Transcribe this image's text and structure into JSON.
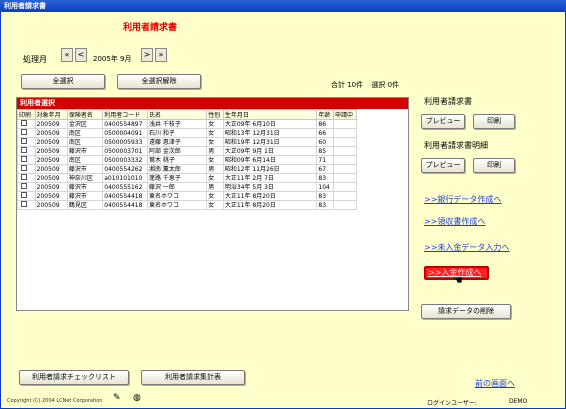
{
  "window": {
    "title": "利用者請求書"
  },
  "form_title": "利用者請求書",
  "period": {
    "label": "処理月",
    "first": "«",
    "prev": "<",
    "value": "2005年 9月",
    "next": ">",
    "last": "»"
  },
  "toolbar": {
    "select_all": "全選択",
    "deselect_all": "全選択解除"
  },
  "summary": {
    "total": "合計 10件",
    "selected": "選択 0件"
  },
  "grid": {
    "title": "利用者選択",
    "columns": [
      "印刷",
      "対象年月",
      "保険者名",
      "利用者コード",
      "氏名",
      "性別",
      "生年月日",
      "年齢",
      "申請中"
    ],
    "rows": [
      [
        "",
        "200509",
        "金沢区",
        "0400554897",
        "浅井 千枝子",
        "女",
        "大正09年 6月10日",
        "86",
        ""
      ],
      [
        "",
        "200509",
        "南区",
        "0500004091",
        "石川 和子",
        "女",
        "昭和13年 12月31日",
        "66",
        ""
      ],
      [
        "",
        "200509",
        "南区",
        "0500005933",
        "遠藤 惠津子",
        "女",
        "昭和19年 12月31日",
        "60",
        ""
      ],
      [
        "",
        "200509",
        "藤沢市",
        "0500003701",
        "阿部 金次郎",
        "男",
        "大正09年 9月 1日",
        "85",
        ""
      ],
      [
        "",
        "200509",
        "南区",
        "0500003332",
        "鷲木 桃子",
        "女",
        "昭和09年 6月14日",
        "71",
        ""
      ],
      [
        "",
        "200509",
        "藤沢市",
        "0400554262",
        "湘南 薫太郎",
        "男",
        "昭和12年 11月26日",
        "67",
        ""
      ],
      [
        "",
        "200509",
        "神奈川区",
        "a010101010",
        "蓬路 千恵子",
        "女",
        "大正11年 2月 7日",
        "83",
        ""
      ],
      [
        "",
        "200509",
        "藤沢市",
        "0400555162",
        "藤沢 一郎",
        "男",
        "明治34年 5月 3日",
        "104",
        ""
      ],
      [
        "",
        "200509",
        "藤沢市",
        "0400554418",
        "東名ホワコ",
        "女",
        "大正11年 8月20日",
        "83",
        ""
      ],
      [
        "",
        "200509",
        "鶴見区",
        "0400554418",
        "東名ホワコ",
        "女",
        "大正11年 8月20日",
        "83",
        ""
      ]
    ]
  },
  "invoice_section": {
    "label": "利用者請求書",
    "preview": "プレビュー",
    "print": "印刷"
  },
  "detail_section": {
    "label": "利用者請求書明細",
    "preview": "プレビュー",
    "print": "印刷"
  },
  "links": {
    "bank_data": ">>銀行データ作成へ",
    "receipt": ">>領収書作成へ",
    "unpaid": ">>未入金データ入力へ",
    "deposit": ">>入金作成へ"
  },
  "delete_button": "請求データの削除",
  "bottom": {
    "checklist": "利用者請求チェックリスト",
    "summary_table": "利用者請求集計表",
    "back_link": "前の画面へ"
  },
  "footer": {
    "copyright": "Copyright (C) 2004 LCNet Corporation",
    "login_label": "ログインユーザー:",
    "login_user": "DEMO"
  }
}
